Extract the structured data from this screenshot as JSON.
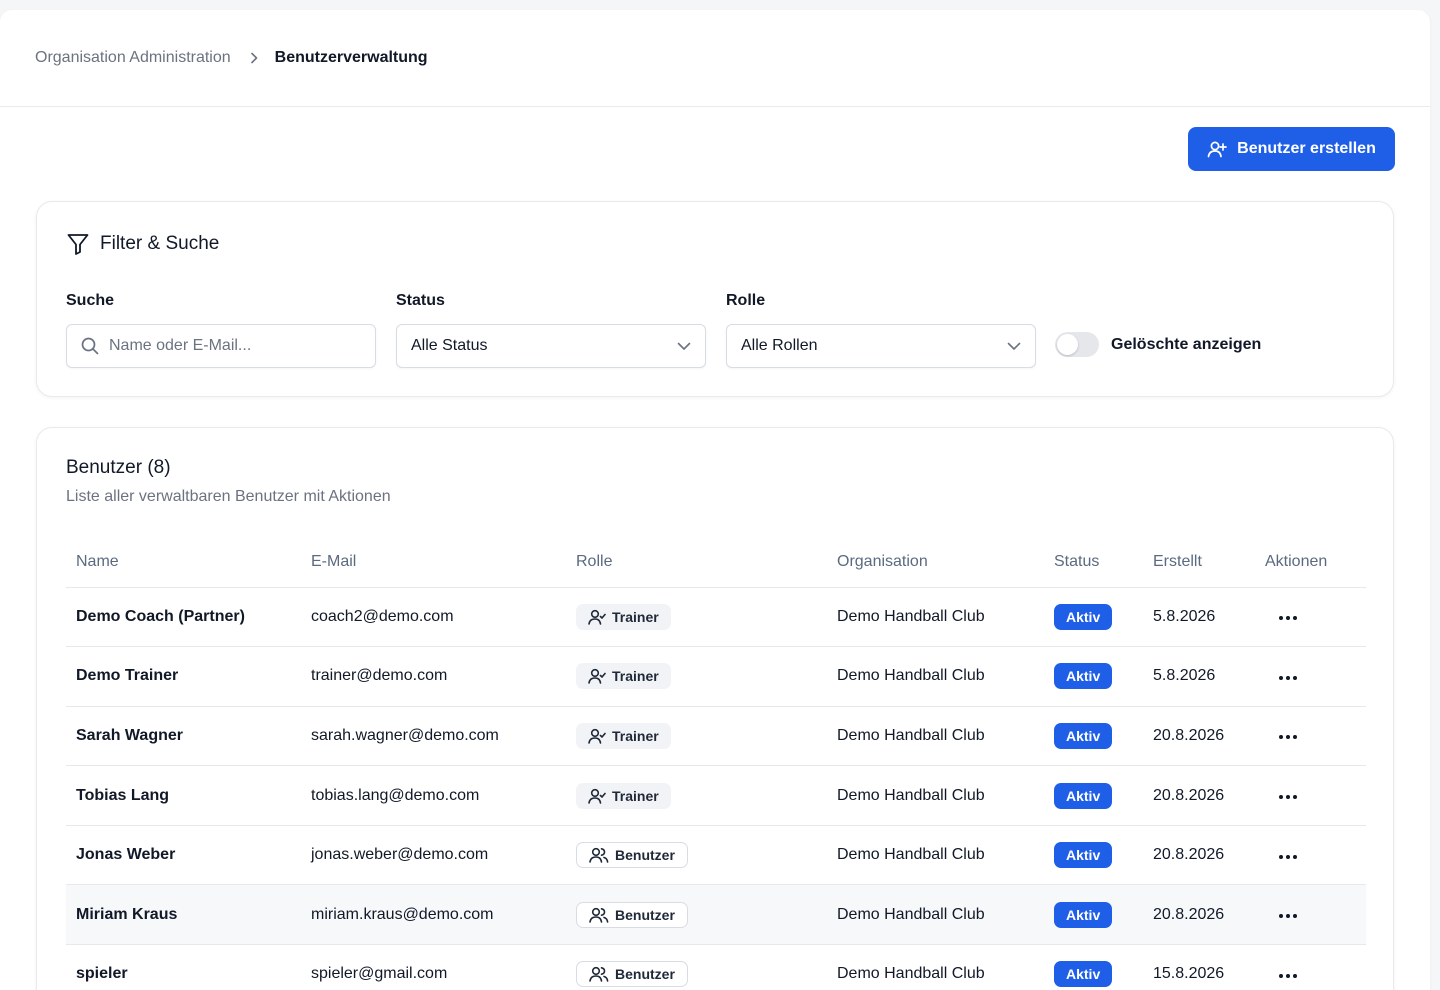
{
  "breadcrumb": {
    "parent": "Organisation Administration",
    "current": "Benutzerverwaltung"
  },
  "actions": {
    "create_user_label": "Benutzer erstellen"
  },
  "filter": {
    "title": "Filter & Suche",
    "search_label": "Suche",
    "search_placeholder": "Name oder E-Mail...",
    "status_label": "Status",
    "status_value": "Alle Status",
    "role_label": "Rolle",
    "role_value": "Alle Rollen",
    "show_deleted_label": "Gelöschte anzeigen",
    "show_deleted_on": false
  },
  "users": {
    "title": "Benutzer (8)",
    "subtitle": "Liste aller verwaltbaren Benutzer mit Aktionen",
    "columns": [
      "Name",
      "E-Mail",
      "Rolle",
      "Organisation",
      "Status",
      "Erstellt",
      "Aktionen"
    ],
    "rows": [
      {
        "name": "Demo Coach (Partner)",
        "email": "coach2@demo.com",
        "role": "Trainer",
        "org": "Demo Handball Club",
        "status": "Aktiv",
        "created": "5.8.2026"
      },
      {
        "name": "Demo Trainer",
        "email": "trainer@demo.com",
        "role": "Trainer",
        "org": "Demo Handball Club",
        "status": "Aktiv",
        "created": "5.8.2026"
      },
      {
        "name": "Sarah Wagner",
        "email": "sarah.wagner@demo.com",
        "role": "Trainer",
        "org": "Demo Handball Club",
        "status": "Aktiv",
        "created": "20.8.2026"
      },
      {
        "name": "Tobias Lang",
        "email": "tobias.lang@demo.com",
        "role": "Trainer",
        "org": "Demo Handball Club",
        "status": "Aktiv",
        "created": "20.8.2026"
      },
      {
        "name": "Jonas Weber",
        "email": "jonas.weber@demo.com",
        "role": "Benutzer",
        "org": "Demo Handball Club",
        "status": "Aktiv",
        "created": "20.8.2026"
      },
      {
        "name": "Miriam Kraus",
        "email": "miriam.kraus@demo.com",
        "role": "Benutzer",
        "org": "Demo Handball Club",
        "status": "Aktiv",
        "created": "20.8.2026"
      },
      {
        "name": "spieler",
        "email": "spieler@gmail.com",
        "role": "Benutzer",
        "org": "Demo Handball Club",
        "status": "Aktiv",
        "created": "15.8.2026"
      }
    ]
  },
  "colors": {
    "accent": "#1f5fe8",
    "muted_text": "#6b7280"
  }
}
